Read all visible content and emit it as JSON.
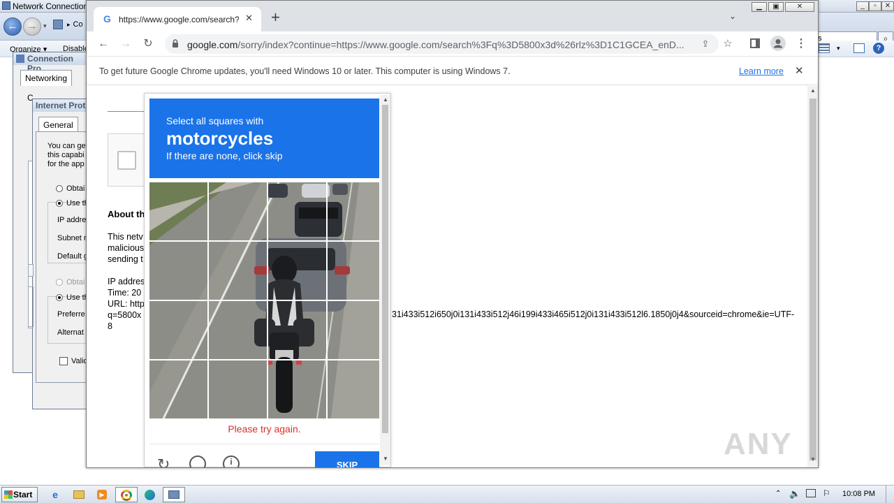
{
  "network_window": {
    "title": "Network Connections",
    "address_crumb": "Co",
    "search_value": "ns",
    "command_bar": {
      "organize": "Organize ▾",
      "disable": "Disable"
    }
  },
  "connection_dialog": {
    "title": "Connection Pro",
    "tab": "Networking",
    "behind_label": "C"
  },
  "ip_dialog": {
    "title": "Internet Prot",
    "tab": "General",
    "desc_lines": [
      "You can ge",
      "this capabi",
      "for the app"
    ],
    "side_label": "T",
    "obtain_ip": "Obtai",
    "use_ip": "Use th",
    "ip_address": "IP addre",
    "subnet": "Subnet r",
    "gateway": "Default g",
    "obtain_dns": "Obtai",
    "use_dns": "Use th",
    "preferred": "Preferre",
    "alternate": "Alternat",
    "validate": "Valid"
  },
  "chrome": {
    "tab_title": "https://www.google.com/search?q=",
    "url_host": "google.com",
    "url_rest": "/sorry/index?continue=https://www.google.com/search%3Fq%3D5800x3d%26rlz%3D1C1GCEA_enD...",
    "infobar_text": "To get future Google Chrome updates, you'll need Windows 10 or later. This computer is using Windows 7.",
    "infobar_link": "Learn more"
  },
  "sorry_page": {
    "about_heading": "About th",
    "about_lines": [
      "This netv",
      "malicious",
      "sending t"
    ],
    "ip_line": "IP addres",
    "time_line": "Time: 20",
    "url_line": "URL: http",
    "url_tail_prefix": "q=5800x",
    "url_tail": "31i433i512i650j0i131i433i512j46i199i433i465i512j0i131i433i512l6.1850j0j4&sourceid=chrome&ie=UTF-",
    "url_wrap": "8"
  },
  "captcha": {
    "instruction_small": "Select all squares with",
    "instruction_target": "motorcycles",
    "instruction_hint": "If there are none, click skip",
    "error": "Please try again.",
    "skip_button": "SKIP"
  },
  "taskbar": {
    "start": "Start",
    "clock": "10:08 PM"
  },
  "watermark": "ANY RUN",
  "colors": {
    "captcha_blue": "#1a73e8",
    "error_red": "#d93025",
    "link_blue": "#1a73e8"
  }
}
